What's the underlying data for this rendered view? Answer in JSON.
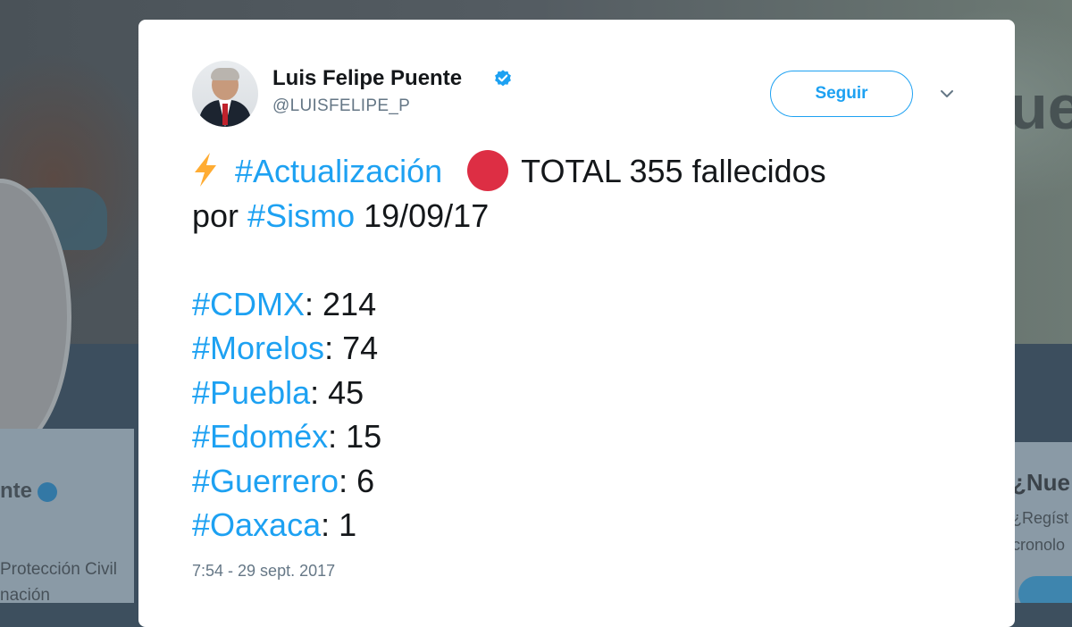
{
  "background": {
    "profile_name_partial": "nte",
    "bio_line_1": "Protección Civil",
    "bio_line_2": "nación",
    "right_card_title": "¿Nue",
    "right_card_line_1": "¿Regíst",
    "right_card_line_2": "cronolo",
    "header_text_partial": "ue"
  },
  "tweet": {
    "author_name": "Luis Felipe Puente",
    "author_handle": "@LUISFELIPE_P",
    "follow_label": "Seguir",
    "line1": {
      "hashtag": "#Actualización",
      "text": "TOTAL 355 fallecidos"
    },
    "line2": {
      "prefix": "por ",
      "hashtag": "#Sismo",
      "text": " 19/09/17"
    },
    "states": [
      {
        "hashtag": "#CDMX",
        "value": ": 214"
      },
      {
        "hashtag": "#Morelos",
        "value": ": 74"
      },
      {
        "hashtag": "#Puebla",
        "value": ": 45"
      },
      {
        "hashtag": "#Edoméx",
        "value": ": 15"
      },
      {
        "hashtag": "#Guerrero",
        "value": ": 6"
      },
      {
        "hashtag": "#Oaxaca",
        "value": ": 1"
      }
    ],
    "timestamp": "7:54 - 29 sept. 2017"
  },
  "icons": {
    "verified": "verified-badge-icon",
    "lightning": "high-voltage-emoji",
    "red_circle": "red-circle-emoji",
    "chevron": "chevron-down-icon"
  },
  "colors": {
    "link": "#1da1f2",
    "text": "#14171a",
    "secondary": "#657786",
    "red_circle": "#dd2e44",
    "lightning": "#ffac33"
  }
}
